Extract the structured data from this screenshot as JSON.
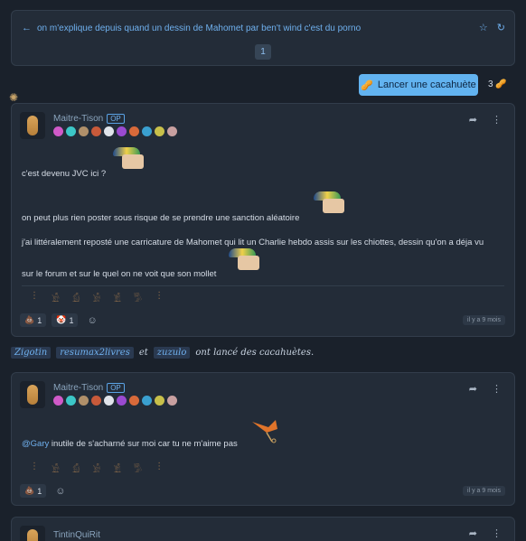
{
  "topic": {
    "title": "on m'explique depuis quand un dessin de Mahomet par ben't wind c'est du porno",
    "page": "1"
  },
  "peanut_button": {
    "label": "Lancer une cacahuète",
    "count": "3"
  },
  "posts": [
    {
      "author": "Maitre-Tison",
      "op_tag": "OP",
      "lines": [
        "c'est devenu JVC ici ?",
        "on peut plus rien poster sous risque de se prendre une sanction aléatoire",
        "j'ai littéralement reposté une carricature de Mahomet qui lit un Charlie hebdo assis sur les chiottes, dessin qu'on a déja vu",
        "sur le forum et sur le quel on ne voit que son mollet"
      ],
      "reactions": [
        {
          "count": "1"
        },
        {
          "count": "1"
        }
      ],
      "timestamp": "il y a 9 mois"
    },
    {
      "author": "Maitre-Tison",
      "op_tag": "OP",
      "mention": "@Gary",
      "text": " inutile de s'acharné sur moi car tu ne m'aime pas",
      "reactions": [
        {
          "count": "1"
        }
      ],
      "timestamp": "il y a 9 mois"
    },
    {
      "author": "TintinQuiRit"
    }
  ],
  "peanut_throwers": {
    "users": [
      "Zigotin",
      "resumax2livres",
      "zuzulo"
    ],
    "connector": "et",
    "suffix": "ont lancé des cacahuètes."
  },
  "colors": {
    "accent": "#6fb0ee",
    "button": "#62b3f0",
    "background": "#1a212b",
    "card": "#232c38"
  }
}
